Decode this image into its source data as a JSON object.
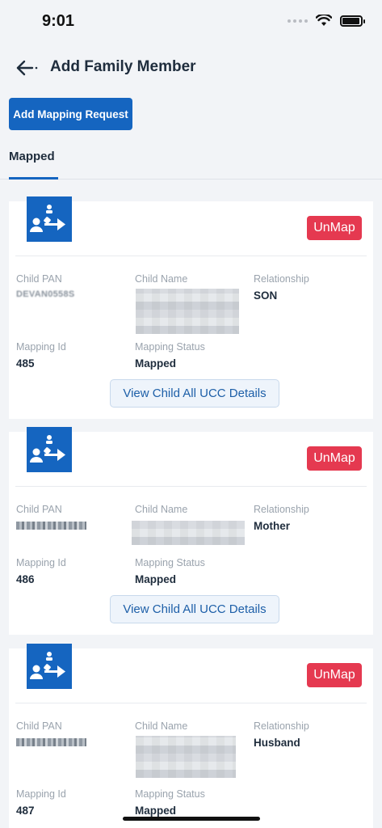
{
  "status_bar": {
    "time": "9:01"
  },
  "header": {
    "title": "Add Family Member"
  },
  "add_mapping_label": "Add Mapping Request",
  "tabs": [
    {
      "label": "Mapped"
    }
  ],
  "labels": {
    "child_pan": "Child PAN",
    "child_name": "Child Name",
    "relationship": "Relationship",
    "mapping_id": "Mapping Id",
    "mapping_status": "Mapping Status",
    "unmap": "UnMap",
    "view_ucc": "View Child All UCC Details"
  },
  "cards": [
    {
      "child_pan": "DEVAN0558S",
      "relationship": "SON",
      "mapping_id": "485",
      "mapping_status": "Mapped"
    },
    {
      "child_pan": "",
      "relationship": "Mother",
      "mapping_id": "486",
      "mapping_status": "Mapped"
    },
    {
      "child_pan": "",
      "relationship": "Husband",
      "mapping_id": "487",
      "mapping_status": "Mapped"
    }
  ],
  "colors": {
    "primary": "#1565c0",
    "danger": "#e53950",
    "background": "#f2f4f7"
  }
}
